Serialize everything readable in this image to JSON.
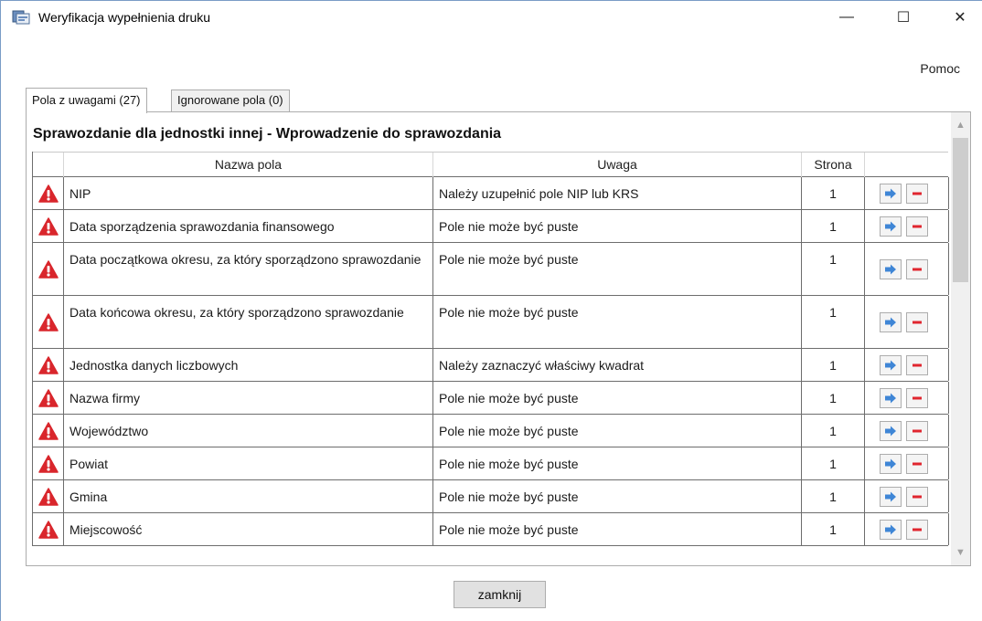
{
  "window": {
    "title": "Weryfikacja wypełnienia druku",
    "minimize_glyph": "—",
    "maximize_glyph": "☐",
    "close_glyph": "✕",
    "help_label": "Pomoc"
  },
  "tabs": [
    {
      "label": "Pola z uwagami (27)",
      "active": true
    },
    {
      "label": "Ignorowane pola (0)",
      "active": false
    }
  ],
  "section": {
    "title": "Sprawozdanie dla jednostki innej - Wprowadzenie do sprawozdania"
  },
  "table": {
    "columns": [
      "Nazwa pola",
      "Uwaga",
      "Strona"
    ],
    "rows": [
      {
        "name": "NIP",
        "note": "Należy uzupełnić pole NIP lub KRS",
        "page": "1"
      },
      {
        "name": "Data sporządzenia sprawozdania finansowego",
        "note": "Pole nie może być puste",
        "page": "1"
      },
      {
        "name": "Data początkowa okresu, za który sporządzono sprawozdanie",
        "note": "Pole nie może być puste",
        "page": "1"
      },
      {
        "name": "Data końcowa okresu, za który sporządzono sprawozdanie",
        "note": "Pole nie może być puste",
        "page": "1"
      },
      {
        "name": "Jednostka danych liczbowych",
        "note": "Należy zaznaczyć właściwy kwadrat",
        "page": "1"
      },
      {
        "name": "Nazwa firmy",
        "note": "Pole nie może być puste",
        "page": "1"
      },
      {
        "name": "Województwo",
        "note": "Pole nie może być puste",
        "page": "1"
      },
      {
        "name": "Powiat",
        "note": "Pole nie może być puste",
        "page": "1"
      },
      {
        "name": "Gmina",
        "note": "Pole nie może być puste",
        "page": "1"
      },
      {
        "name": "Miejscowość",
        "note": "Pole nie może być puste",
        "page": "1"
      }
    ]
  },
  "footer": {
    "close_label": "zamknij"
  },
  "colors": {
    "warning": "#d9262c",
    "arrow": "#3f86d6",
    "remove": "#e0262f",
    "border": "#6d6d6d"
  },
  "icons": {
    "row_status": "warning-icon",
    "go_to": "arrow-right-icon",
    "ignore": "minus-icon"
  }
}
